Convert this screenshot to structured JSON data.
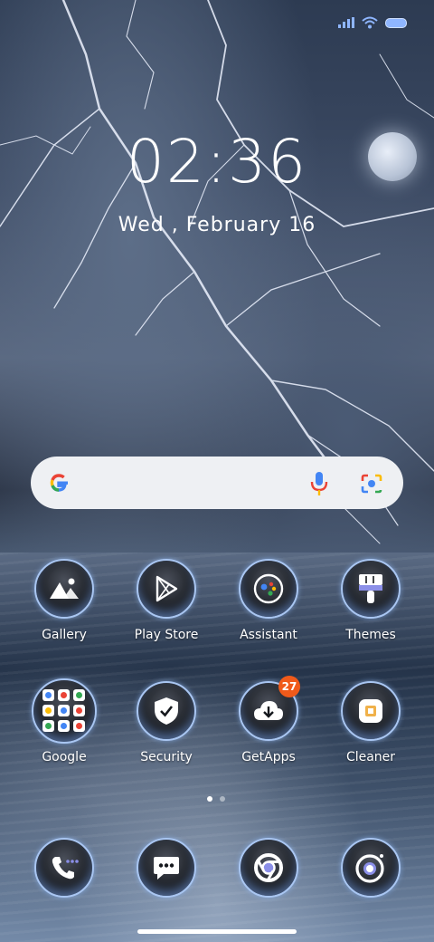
{
  "status_bar": {
    "icons": [
      "signal-icon",
      "wifi-icon",
      "battery-icon"
    ]
  },
  "clock": {
    "time": "02:36",
    "date": "Wed , February 16"
  },
  "search": {
    "icons": [
      "google-g-icon",
      "microphone-icon",
      "google-lens-icon"
    ]
  },
  "apps": [
    {
      "label": "Gallery",
      "icon": "gallery-icon"
    },
    {
      "label": "Play Store",
      "icon": "play-store-icon"
    },
    {
      "label": "Assistant",
      "icon": "assistant-icon"
    },
    {
      "label": "Themes",
      "icon": "themes-icon"
    },
    {
      "label": "Google",
      "icon": "google-folder-icon"
    },
    {
      "label": "Security",
      "icon": "security-icon"
    },
    {
      "label": "GetApps",
      "icon": "getapps-icon",
      "badge": "27"
    },
    {
      "label": "Cleaner",
      "icon": "cleaner-icon"
    }
  ],
  "dock": [
    {
      "icon": "phone-icon"
    },
    {
      "icon": "messages-icon"
    },
    {
      "icon": "chrome-icon"
    },
    {
      "icon": "camera-icon"
    }
  ],
  "colors": {
    "accent_ring": "#a9c6f2",
    "badge": "#f05a1a",
    "search_bg": "#eef0f3"
  }
}
